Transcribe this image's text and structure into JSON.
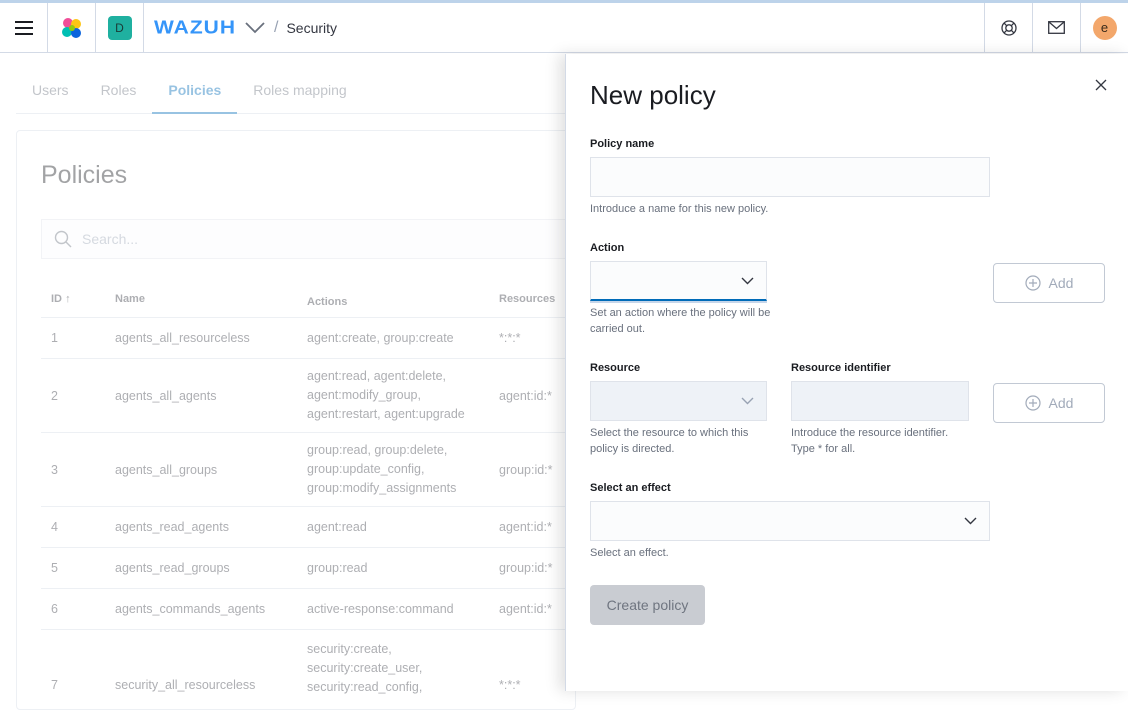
{
  "header": {
    "menu_icon": "hamburger-menu-icon",
    "space_initial": "D",
    "brand": "WAZUH",
    "breadcrumb": "Security",
    "user_initial": "e",
    "colors": {
      "brand": "#3595f9",
      "space_badge": "#1fb0a0",
      "avatar": "#f3a76b"
    }
  },
  "tabs": [
    {
      "label": "Users",
      "active": false
    },
    {
      "label": "Roles",
      "active": false
    },
    {
      "label": "Policies",
      "active": true
    },
    {
      "label": "Roles mapping",
      "active": false
    }
  ],
  "policies_panel": {
    "title": "Policies",
    "search_placeholder": "Search...",
    "columns": [
      "ID",
      "Name",
      "Actions",
      "Resources"
    ],
    "rows": [
      {
        "id": "1",
        "name": "agents_all_resourceless",
        "actions": [
          "agent:create, group:create"
        ],
        "resources": "*:*:*"
      },
      {
        "id": "2",
        "name": "agents_all_agents",
        "actions": [
          "agent:read, agent:delete,",
          "agent:modify_group,",
          "agent:restart, agent:upgrade"
        ],
        "resources": "agent:id:*"
      },
      {
        "id": "3",
        "name": "agents_all_groups",
        "actions": [
          "group:read, group:delete,",
          "group:update_config,",
          "group:modify_assignments"
        ],
        "resources": "group:id:*"
      },
      {
        "id": "4",
        "name": "agents_read_agents",
        "actions": [
          "agent:read"
        ],
        "resources": "agent:id:*"
      },
      {
        "id": "5",
        "name": "agents_read_groups",
        "actions": [
          "group:read"
        ],
        "resources": "group:id:*"
      },
      {
        "id": "6",
        "name": "agents_commands_agents",
        "actions": [
          "active-response:command"
        ],
        "resources": "agent:id:*"
      },
      {
        "id": "7",
        "name": "security_all_resourceless",
        "actions": [
          "security:create,",
          "security:create_user,",
          "security:read_config,"
        ],
        "resources": "*:*:*"
      }
    ]
  },
  "flyout": {
    "title": "New policy",
    "policy_name": {
      "label": "Policy name",
      "value": "",
      "help": "Introduce a name for this new policy."
    },
    "action": {
      "label": "Action",
      "value": "",
      "help": "Set an action where the policy will be carried out."
    },
    "resource": {
      "label": "Resource",
      "value": "",
      "help": "Select the resource to which this policy is directed."
    },
    "resource_identifier": {
      "label": "Resource identifier",
      "value": "",
      "help": "Introduce the resource identifier. Type * for all."
    },
    "effect": {
      "label": "Select an effect",
      "value": "",
      "help": "Select an effect."
    },
    "add_label": "Add",
    "create_label": "Create policy"
  }
}
